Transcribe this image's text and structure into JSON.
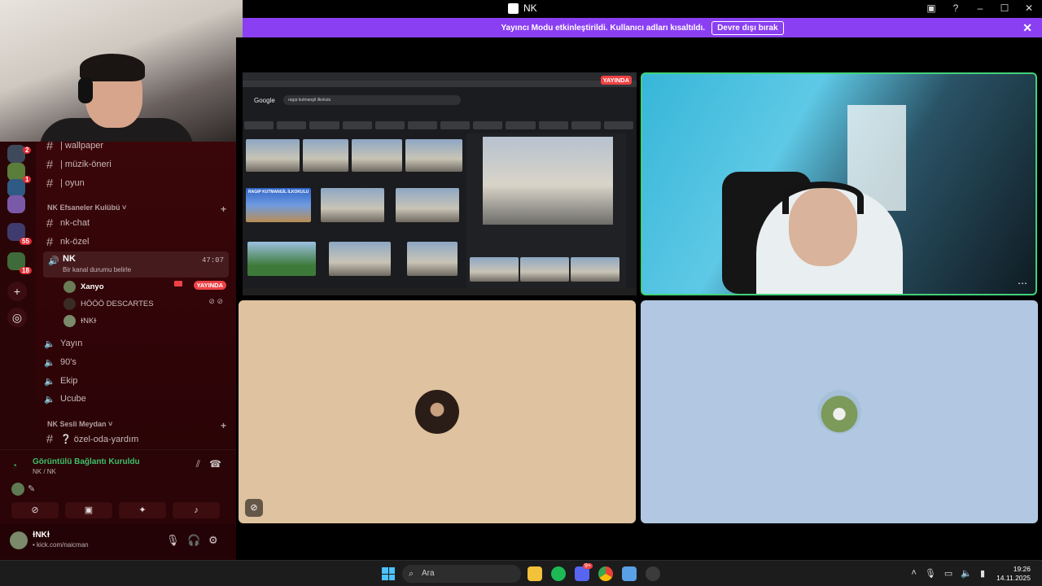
{
  "titlebar": {
    "title": "NK"
  },
  "banner": {
    "message": "Yayıncı Modu etkinleştirildi. Kullanıcı adları kısaltıldı.",
    "disable_label": "Devre dışı bırak",
    "color": "#8b3ff2"
  },
  "rail": {
    "badges": [
      "2",
      "1",
      "55",
      "18"
    ]
  },
  "sidebar": {
    "top_channels": [
      {
        "icon": "wallpaper-icon",
        "label": "| wallpaper"
      },
      {
        "icon": "headphones-icon",
        "label": "| müzik-öneri"
      },
      {
        "icon": "gamepad-icon",
        "label": "| oyun"
      }
    ],
    "category1": "NK Efsaneler Kulübü",
    "text_channels": [
      "nk-chat",
      "nk-özel"
    ],
    "active_voice": {
      "name": "NK",
      "status": "Bir kanal durumu belirle",
      "timer": "47:07"
    },
    "members": [
      {
        "name": "Xanyo",
        "live": "YAYINDA"
      },
      {
        "name": "HÖÖÖ DESCARTES"
      },
      {
        "name": "ɫNKɫ"
      }
    ],
    "voice_channels": [
      "Yayın",
      "90's",
      "Ekip",
      "Ucube"
    ],
    "category2": "NK Sesli Meydan",
    "extra_channel": "❔ özel-oda-yardım"
  },
  "voice_panel": {
    "status": "Görüntülü Bağlantı Kuruldu",
    "channel": "NK / NK"
  },
  "user_panel": {
    "name": "ɫNKɫ",
    "status": "• kick.com/naicman"
  },
  "screenshare": {
    "live_label": "YAYINDA",
    "google_label": "Google",
    "search_text": "ragıp kutmangil ilkokulu",
    "banner_text": "RAGIP KUTMANGİL İLKOKULU"
  },
  "taskbar": {
    "search_placeholder": "Ara",
    "discord_badge": "9+",
    "time": "19:26",
    "date": "14.11.2025"
  }
}
